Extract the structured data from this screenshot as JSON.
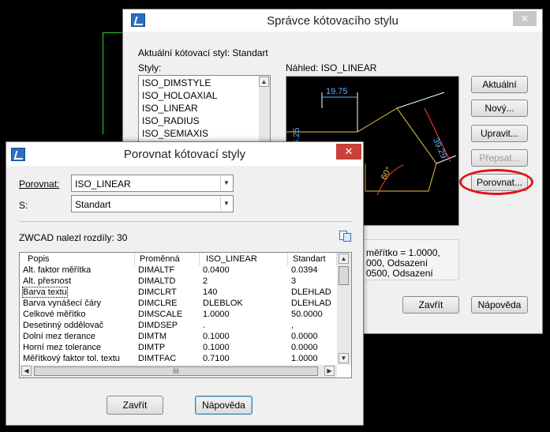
{
  "main": {
    "title": "Správce kótovacího stylu",
    "current_style": "Aktuální kótovací styl: Standart",
    "styles_label": "Styly:",
    "styles": [
      "ISO_DIMSTYLE",
      "ISO_HOLOAXIAL",
      "ISO_LINEAR",
      "ISO_RADIUS",
      "ISO_SEMIAXIS"
    ],
    "preview_label": "Náhled: ISO_LINEAR",
    "preview_dims": [
      "19.75",
      "6.25",
      "39.29",
      "60°"
    ],
    "buttons": {
      "current": "Aktuální",
      "new": "Nový...",
      "modify": "Upravit...",
      "override": "Přepsat...",
      "compare": "Porovnat...",
      "close": "Zavřít",
      "help": "Nápověda"
    },
    "desc_lines": [
      "měřítko = 1.0000,",
      "000, Odsazení",
      "0500, Odsazení"
    ],
    "close_icon": "close-icon"
  },
  "compare": {
    "title": "Porovnat kótovací styly",
    "compare_label": "Porovnat:",
    "compare_value": "ISO_LINEAR",
    "with_label": "S:",
    "with_value": "Standart",
    "found_text": "ZWCAD nalezl rozdíly: 30",
    "columns": [
      "Popis",
      "Proměnná",
      "ISO_LINEAR",
      "Standart"
    ],
    "rows": [
      [
        "Alt. faktor měřítka",
        "DIMALTF",
        "0.0400",
        "0.0394"
      ],
      [
        "Alt. přesnost",
        "DIMALTD",
        "2",
        "3"
      ],
      [
        "Barva textu",
        "DIMCLRT",
        "140",
        "DLEHLAD"
      ],
      [
        "Barva vynášecí čáry",
        "DIMCLRE",
        "DLEBLOK",
        "DLEHLAD"
      ],
      [
        "Celkové měřítko",
        "DIMSCALE",
        "1.0000",
        "50.0000"
      ],
      [
        "Desetinný oddělovač",
        "DIMDSEP",
        ".",
        ","
      ],
      [
        "Dolní mez tlerance",
        "DIMTM",
        "0.1000",
        "0.0000"
      ],
      [
        "Horní mez tolerance",
        "DIMTP",
        "0.1000",
        "0.0000"
      ],
      [
        "Měřítkový faktor tol. textu",
        "DIMTFAC",
        "0.7100",
        "1.0000"
      ]
    ],
    "buttons": {
      "close": "Zavřít",
      "help": "Nápověda"
    },
    "hscroll_grip": "III"
  }
}
